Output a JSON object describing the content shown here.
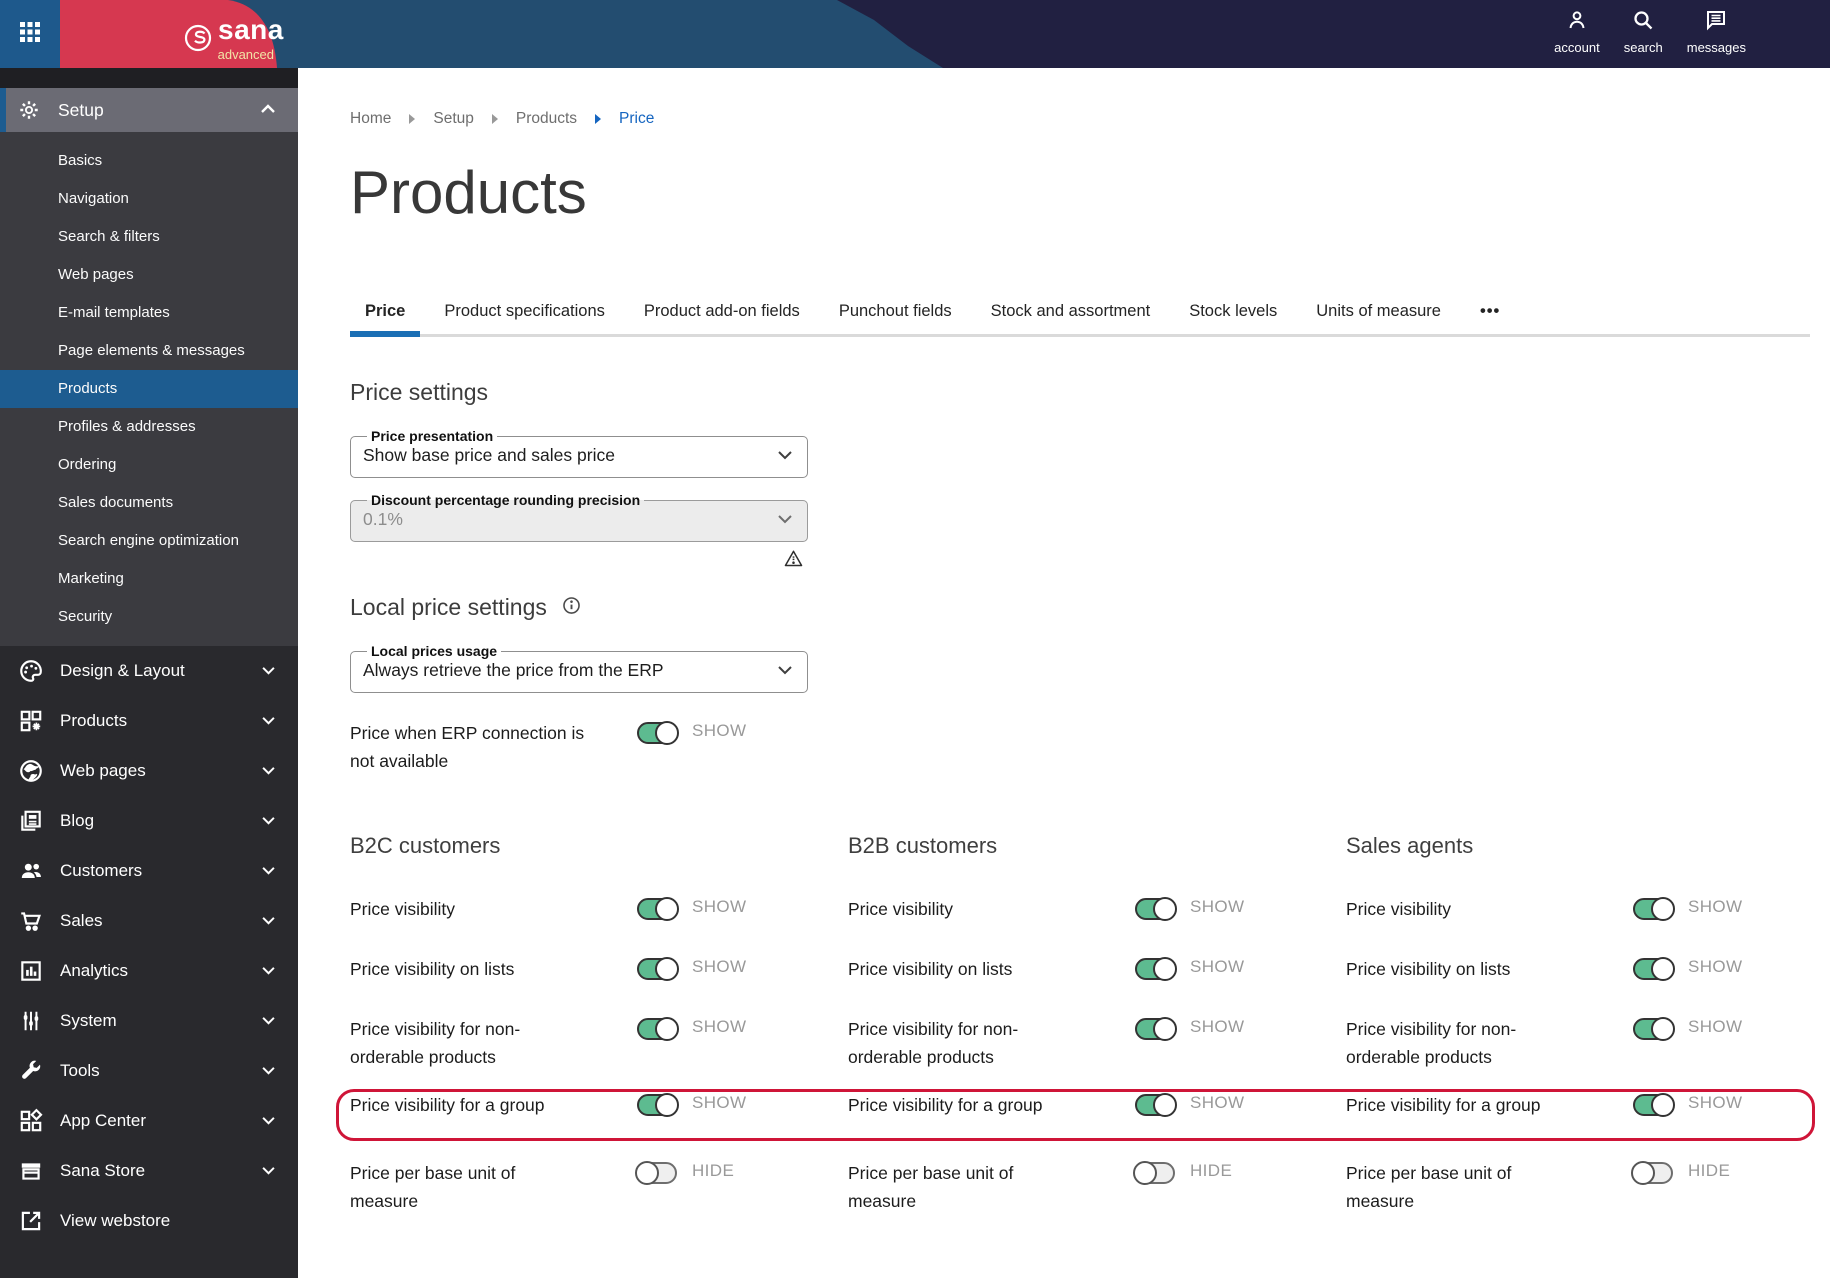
{
  "topbar": {
    "logo": {
      "name": "sana",
      "edition": "advanced"
    },
    "actions": [
      {
        "label": "account"
      },
      {
        "label": "search"
      },
      {
        "label": "messages"
      }
    ]
  },
  "sidebar": {
    "setup_label": "Setup",
    "setup_items": [
      "Basics",
      "Navigation",
      "Search & filters",
      "Web pages",
      "E-mail templates",
      "Page elements & messages",
      "Products",
      "Profiles & addresses",
      "Ordering",
      "Sales documents",
      "Search engine optimization",
      "Marketing",
      "Security"
    ],
    "selected_item": "Products",
    "sections": [
      {
        "label": "Design & Layout"
      },
      {
        "label": "Products"
      },
      {
        "label": "Web pages"
      },
      {
        "label": "Blog"
      },
      {
        "label": "Customers"
      },
      {
        "label": "Sales"
      },
      {
        "label": "Analytics"
      },
      {
        "label": "System"
      },
      {
        "label": "Tools"
      },
      {
        "label": "App Center"
      },
      {
        "label": "Sana Store"
      }
    ],
    "view_webstore_label": "View webstore"
  },
  "breadcrumb": {
    "items": [
      "Home",
      "Setup",
      "Products"
    ],
    "current": "Price"
  },
  "page": {
    "title": "Products"
  },
  "tabs": {
    "active": "Price",
    "items": [
      "Price",
      "Product specifications",
      "Product add-on fields",
      "Punchout fields",
      "Stock and assortment",
      "Stock levels",
      "Units of measure",
      "•••"
    ]
  },
  "price_settings": {
    "heading": "Price settings",
    "price_presentation": {
      "label": "Price presentation",
      "value": "Show base price and sales price"
    },
    "discount_rounding": {
      "label": "Discount percentage rounding precision",
      "value": "0.1%",
      "disabled": true
    }
  },
  "local_price_settings": {
    "heading": "Local price settings",
    "local_prices_usage": {
      "label": "Local prices usage",
      "value": "Always retrieve the price from the ERP"
    },
    "erp_fallback": {
      "label": "Price when ERP connection is\nnot available",
      "state": "SHOW",
      "on": true
    }
  },
  "visibility_columns": [
    {
      "heading": "B2C customers",
      "rows": [
        {
          "label": "Price visibility",
          "state": "SHOW",
          "on": true
        },
        {
          "label": "Price visibility on lists",
          "state": "SHOW",
          "on": true
        },
        {
          "label": "Price visibility for non-\norderable products",
          "state": "SHOW",
          "on": true
        },
        {
          "label": "Price visibility for a group",
          "state": "SHOW",
          "on": true,
          "highlighted": true
        },
        {
          "label": "Price per base unit of\nmeasure",
          "state": "HIDE",
          "on": false
        }
      ]
    },
    {
      "heading": "B2B customers",
      "rows": [
        {
          "label": "Price visibility",
          "state": "SHOW",
          "on": true
        },
        {
          "label": "Price visibility on lists",
          "state": "SHOW",
          "on": true
        },
        {
          "label": "Price visibility for non-\norderable products",
          "state": "SHOW",
          "on": true
        },
        {
          "label": "Price visibility for a group",
          "state": "SHOW",
          "on": true,
          "highlighted": true
        },
        {
          "label": "Price per base unit of\nmeasure",
          "state": "HIDE",
          "on": false
        }
      ]
    },
    {
      "heading": "Sales agents",
      "rows": [
        {
          "label": "Price visibility",
          "state": "SHOW",
          "on": true
        },
        {
          "label": "Price visibility on lists",
          "state": "SHOW",
          "on": true
        },
        {
          "label": "Price visibility for non-\norderable products",
          "state": "SHOW",
          "on": true
        },
        {
          "label": "Price visibility for a group",
          "state": "SHOW",
          "on": true,
          "highlighted": true
        },
        {
          "label": "Price per base unit of\nmeasure",
          "state": "HIDE",
          "on": false
        }
      ]
    }
  ],
  "colors": {
    "topbar_blue": "#234d70",
    "topbar_navy": "#212041",
    "brand_red": "#d63850",
    "accent_blue": "#1d5c90",
    "tab_blue": "#1a6fb5",
    "link_blue": "#1565c0",
    "toggle_green": "#5dbb90",
    "highlight_red": "#cf1538"
  }
}
